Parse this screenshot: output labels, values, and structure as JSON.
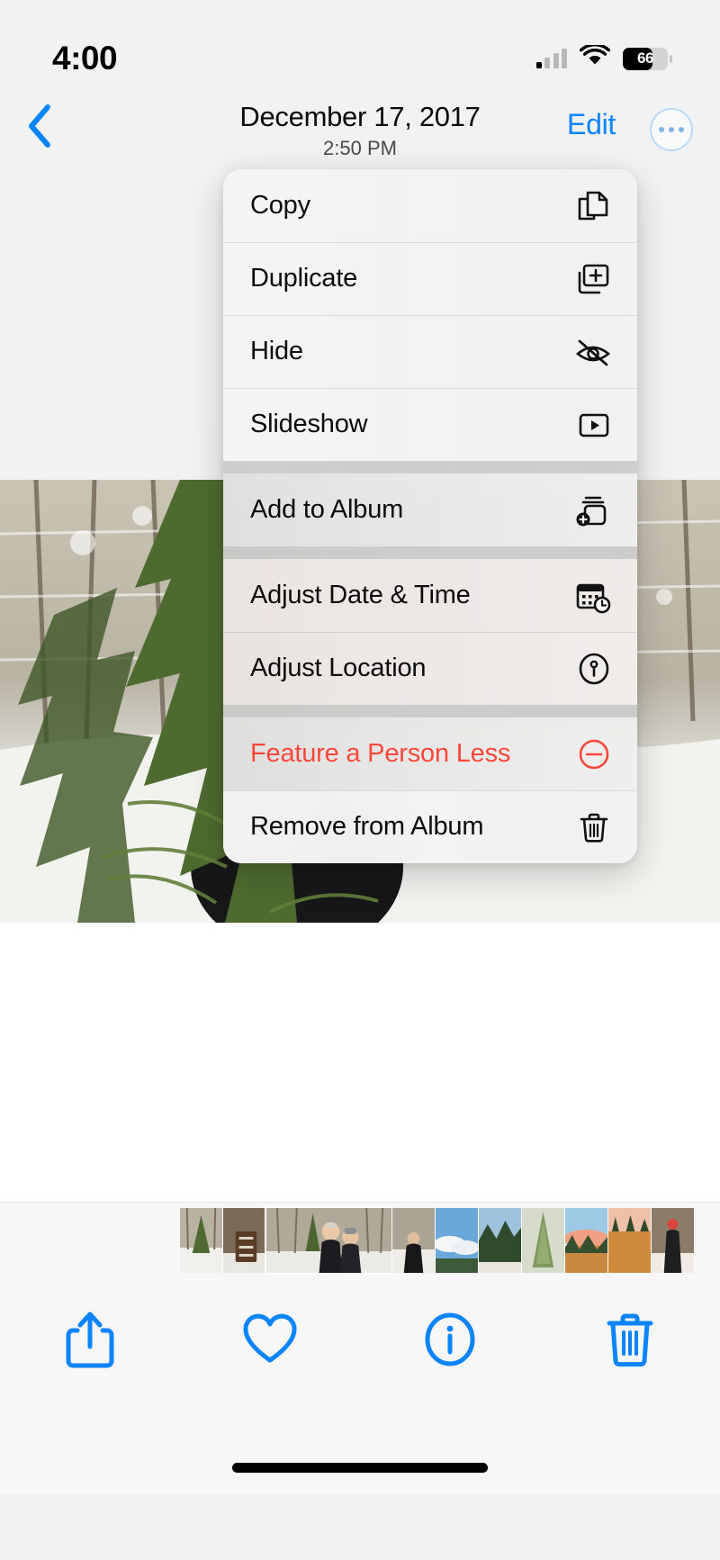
{
  "status_bar": {
    "time": "4:00",
    "cellular_icon": "cellular-signal-icon",
    "wifi_icon": "wifi-icon",
    "battery_icon": "battery-icon",
    "battery_percent": "66",
    "battery_level": 66
  },
  "nav_bar": {
    "back_icon": "chevron-left-icon",
    "title": "December 17, 2017",
    "subtitle": "2:50 PM",
    "edit_label": "Edit",
    "more_icon": "ellipsis-circle-icon"
  },
  "context_menu": {
    "groups": [
      {
        "items": [
          {
            "label": "Copy",
            "icon": "copy-document-icon",
            "destructive": false,
            "tint": ""
          },
          {
            "label": "Duplicate",
            "icon": "duplicate-plus-icon",
            "destructive": false,
            "tint": ""
          },
          {
            "label": "Hide",
            "icon": "eye-slash-icon",
            "destructive": false,
            "tint": ""
          },
          {
            "label": "Slideshow",
            "icon": "play-rectangle-icon",
            "destructive": false,
            "tint": ""
          }
        ]
      },
      {
        "items": [
          {
            "label": "Add to Album",
            "icon": "add-to-album-icon",
            "destructive": false,
            "tint": "tint-grey"
          }
        ]
      },
      {
        "items": [
          {
            "label": "Adjust Date & Time",
            "icon": "calendar-clock-icon",
            "destructive": false,
            "tint": "tint-warm"
          },
          {
            "label": "Adjust Location",
            "icon": "location-pin-circle-icon",
            "destructive": false,
            "tint": "tint-warmer"
          }
        ]
      },
      {
        "items": [
          {
            "label": "Feature a Person Less",
            "icon": "minus-circle-icon",
            "destructive": true,
            "tint": "tint-grey"
          },
          {
            "label": "Remove from Album",
            "icon": "trash-icon",
            "destructive": false,
            "tint": ""
          }
        ]
      }
    ]
  },
  "photo": {
    "description": "Snowy forest with evergreen branches and a person in dark clothing",
    "alt": "December 17 2017 winter forest photo"
  },
  "filmstrip": {
    "thumbnails": [
      {
        "name": "thumb-snowy-trees",
        "kind": "small",
        "selected": false
      },
      {
        "name": "thumb-trail-sign",
        "kind": "small",
        "selected": false
      },
      {
        "name": "thumb-two-people",
        "kind": "wide",
        "selected": true
      },
      {
        "name": "thumb-person-walking",
        "kind": "small",
        "selected": false
      },
      {
        "name": "thumb-blue-sky-clouds",
        "kind": "small",
        "selected": false
      },
      {
        "name": "thumb-forest-ridge",
        "kind": "small",
        "selected": false
      },
      {
        "name": "thumb-pine-branch",
        "kind": "small",
        "selected": false
      },
      {
        "name": "thumb-sunset-field",
        "kind": "small",
        "selected": false
      },
      {
        "name": "thumb-orange-grass",
        "kind": "small",
        "selected": false
      },
      {
        "name": "thumb-red-hat-person",
        "kind": "small",
        "selected": false
      }
    ]
  },
  "toolbar": {
    "buttons": [
      {
        "name": "share-button",
        "icon": "share-up-arrow-icon",
        "label": "Share"
      },
      {
        "name": "favorite-button",
        "icon": "heart-icon",
        "label": "Favorite"
      },
      {
        "name": "info-button",
        "icon": "info-circle-icon",
        "label": "Info"
      },
      {
        "name": "delete-button",
        "icon": "trash-icon",
        "label": "Delete"
      }
    ],
    "accent_color": "#0a84ff"
  },
  "colors": {
    "accent": "#0a84ff",
    "destructive": "#ff483a",
    "menu_background": "#f2f2f2",
    "background": "#f7f7f7"
  }
}
